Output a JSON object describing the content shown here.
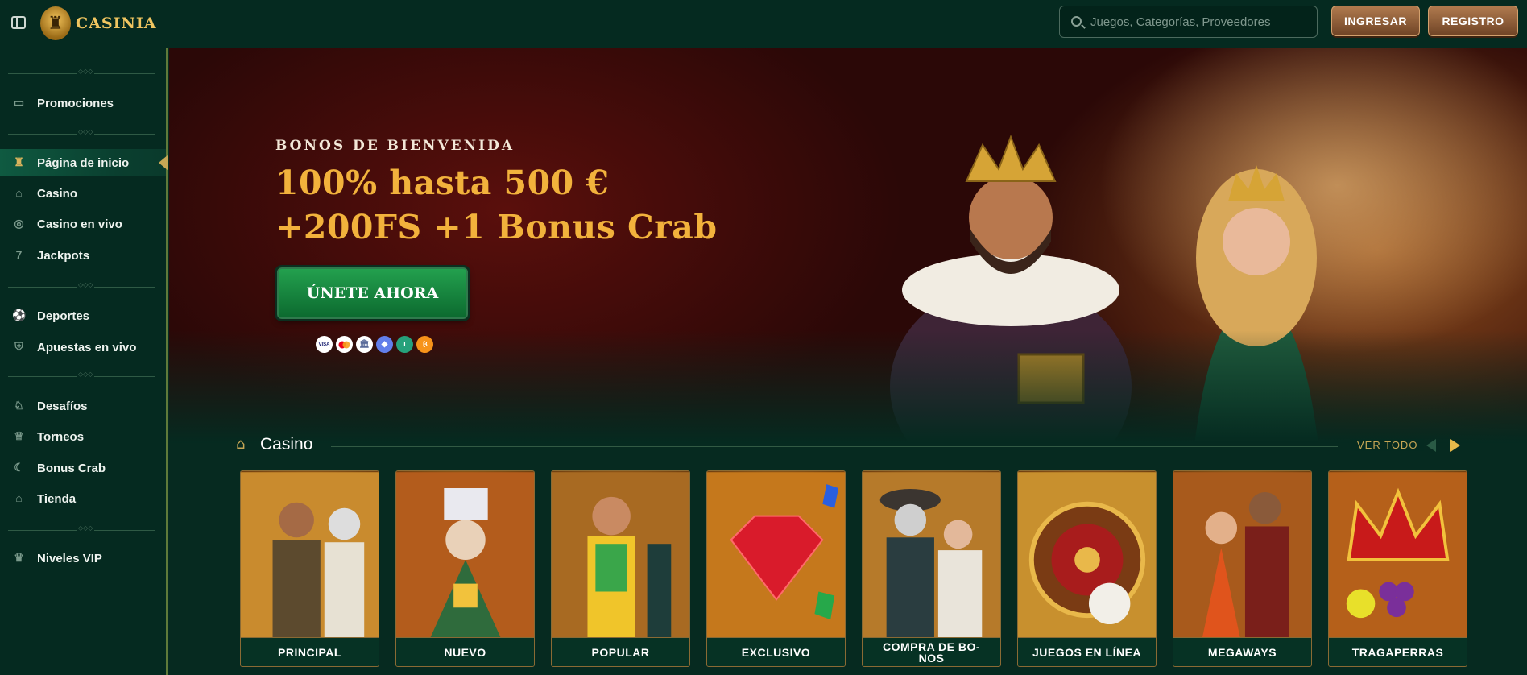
{
  "brand": {
    "name": "CASINIA"
  },
  "header": {
    "search_placeholder": "Juegos, Categorías, Proveedores",
    "login_label": "INGRESAR",
    "register_label": "REGISTRO"
  },
  "sidebar": {
    "items": [
      {
        "label": "Promociones",
        "icon": "gift-box-icon"
      },
      {
        "label": "Página de inicio",
        "icon": "castle-icon",
        "active": true
      },
      {
        "label": "Casino",
        "icon": "casino-icon"
      },
      {
        "label": "Casino en vivo",
        "icon": "live-chip-icon"
      },
      {
        "label": "Jackpots",
        "icon": "seven-icon"
      },
      {
        "label": "Deportes",
        "icon": "soccer-ball-icon"
      },
      {
        "label": "Apuestas en vivo",
        "icon": "live-bet-icon"
      },
      {
        "label": "Desafíos",
        "icon": "challenge-icon"
      },
      {
        "label": "Torneos",
        "icon": "trophy-icon"
      },
      {
        "label": "Bonus Crab",
        "icon": "crab-icon"
      },
      {
        "label": "Tienda",
        "icon": "shop-icon"
      },
      {
        "label": "Niveles VIP",
        "icon": "crown-icon"
      }
    ]
  },
  "hero": {
    "subtitle": "BONOS DE BIENVENIDA",
    "title_line1": "100% hasta 500 €",
    "title_line2": "+200FS +1 Bonus Crab",
    "cta_label": "ÚNETE AHORA",
    "payment_methods": [
      {
        "name": "visa-icon",
        "text": "VISA",
        "color": "#ffffff"
      },
      {
        "name": "mastercard-icon",
        "text": "",
        "color": "#eb001b"
      },
      {
        "name": "bank-icon",
        "text": "🏛",
        "color": "#5a6b9a"
      },
      {
        "name": "ethereum-icon",
        "text": "◆",
        "color": "#627eea"
      },
      {
        "name": "tether-icon",
        "text": "T",
        "color": "#26a17b"
      },
      {
        "name": "bitcoin-icon",
        "text": "₿",
        "color": "#f7931a"
      }
    ]
  },
  "casino_section": {
    "title": "Casino",
    "view_all": "VER TODO",
    "categories": [
      "PRINCIPAL",
      "NUEVO",
      "POPULAR",
      "EXCLUSIVO",
      "COMPRA DE BO-NOS",
      "JUEGOS EN LÍNEA",
      "MEGAWAYS",
      "TRAGAPERRAS"
    ]
  }
}
